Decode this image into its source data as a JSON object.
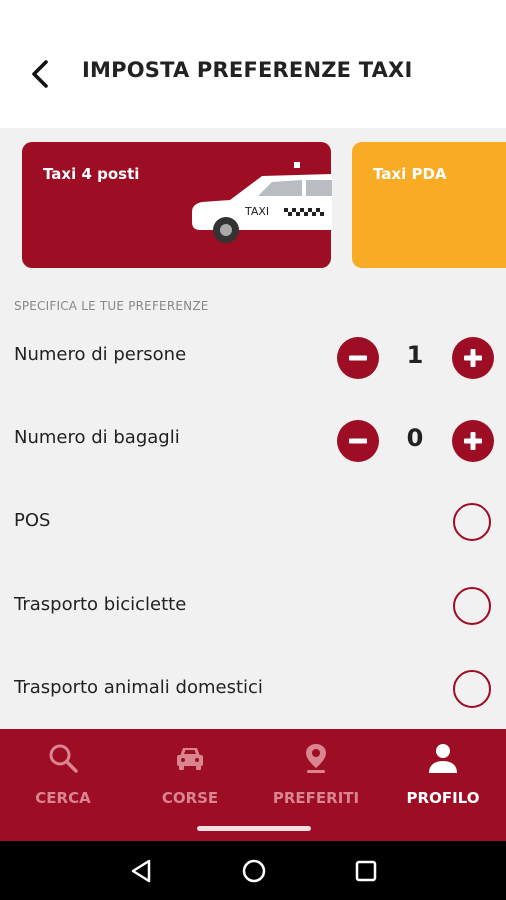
{
  "header": {
    "title": "IMPOSTA PREFERENZE TAXI",
    "back_icon": "chevron-left-icon"
  },
  "cards": [
    {
      "label": "Taxi 4 posti",
      "color": "#9d0d24",
      "taxi_sign": "TAXI",
      "selected": true
    },
    {
      "label": "Taxi PDA",
      "color": "#f8ac25",
      "selected": false
    }
  ],
  "section_label": "SPECIFICA LE TUE PREFERENZE",
  "steppers": [
    {
      "label": "Numero di persone",
      "value": "1"
    },
    {
      "label": "Numero di bagagli",
      "value": "0"
    }
  ],
  "options": [
    {
      "label": "POS",
      "checked": false
    },
    {
      "label": "Trasporto biciclette",
      "checked": false
    },
    {
      "label": "Trasporto animali domestici",
      "checked": false
    }
  ],
  "nav": {
    "items": [
      {
        "label": "CERCA",
        "icon": "search-icon",
        "active": false
      },
      {
        "label": "CORSE",
        "icon": "car-icon",
        "active": false
      },
      {
        "label": "PREFERITI",
        "icon": "location-pin-icon",
        "active": false
      },
      {
        "label": "PROFILO",
        "icon": "person-icon",
        "active": true
      }
    ]
  },
  "colors": {
    "accent": "#9d0d24",
    "secondary": "#f8ac25"
  }
}
